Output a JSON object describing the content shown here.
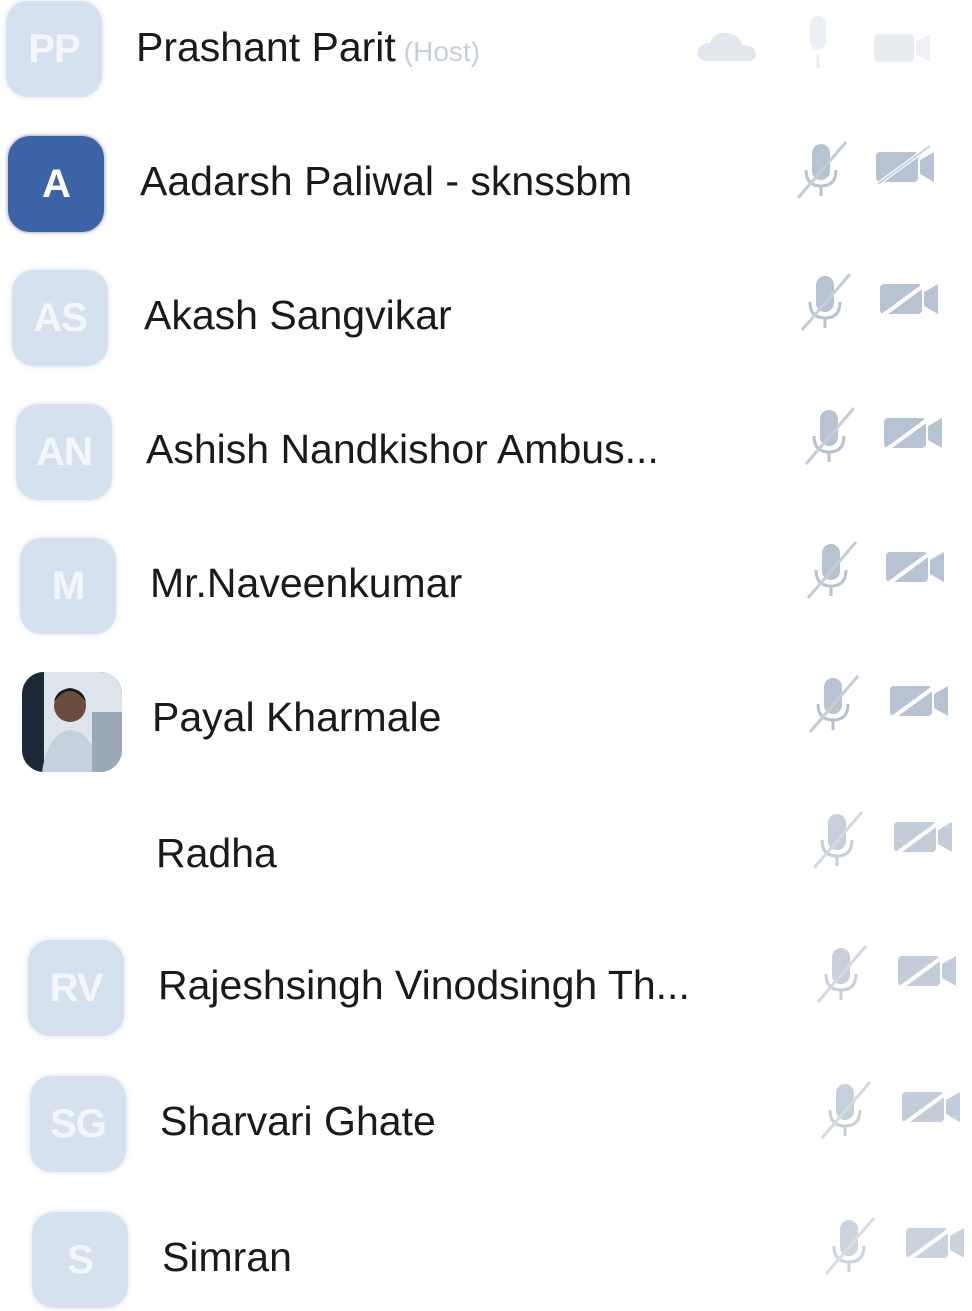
{
  "participants": [
    {
      "initials": "PP",
      "name": "Prashant Parit",
      "tag": "(Host)",
      "avatar_style": "light",
      "mic": "muted",
      "video": "off"
    },
    {
      "initials": "A",
      "name": "Aadarsh Paliwal - sknssbm",
      "tag": "",
      "avatar_style": "dark",
      "mic": "muted",
      "video": "off"
    },
    {
      "initials": "AS",
      "name": "Akash Sangvikar",
      "tag": "",
      "avatar_style": "light",
      "mic": "muted",
      "video": "off"
    },
    {
      "initials": "AN",
      "name": "Ashish Nandkishor Ambus...",
      "tag": "",
      "avatar_style": "light",
      "mic": "muted",
      "video": "off"
    },
    {
      "initials": "M",
      "name": "Mr.Naveenkumar",
      "tag": "",
      "avatar_style": "light",
      "mic": "muted",
      "video": "off"
    },
    {
      "initials": "",
      "name": "Payal Kharmale",
      "tag": "",
      "avatar_style": "photo",
      "mic": "muted",
      "video": "off"
    },
    {
      "initials": "",
      "name": "Radha",
      "tag": "",
      "avatar_style": "none",
      "mic": "muted",
      "video": "off"
    },
    {
      "initials": "RV",
      "name": "Rajeshsingh Vinodsingh Th...",
      "tag": "",
      "avatar_style": "light",
      "mic": "muted",
      "video": "off"
    },
    {
      "initials": "SG",
      "name": "Sharvari Ghate",
      "tag": "",
      "avatar_style": "light",
      "mic": "muted",
      "video": "off"
    },
    {
      "initials": "S",
      "name": "Simran",
      "tag": "",
      "avatar_style": "light",
      "mic": "muted",
      "video": "off"
    }
  ],
  "icons": {
    "host_extra": "cloud-icon",
    "mic": "microphone-muted-icon",
    "video": "video-off-icon"
  },
  "colors": {
    "avatar_light": "#d6e1f0",
    "avatar_dark": "#3c63a6",
    "icon_gray": "#b7c2d2",
    "name_text": "#1a1a1a",
    "host_tag": "#c9cfd8"
  }
}
